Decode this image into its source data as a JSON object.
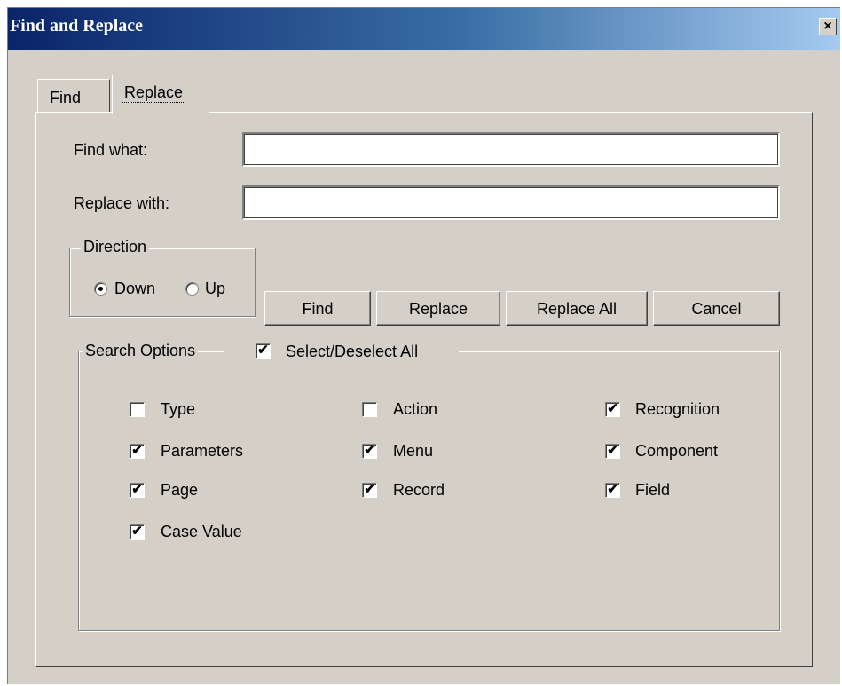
{
  "window": {
    "title": "Find and Replace",
    "close_glyph": "×"
  },
  "tabs": [
    {
      "label": "Find",
      "selected": false
    },
    {
      "label": "Replace",
      "selected": true
    }
  ],
  "fields": {
    "find_what": {
      "label": "Find what:",
      "value": ""
    },
    "replace_with": {
      "label": "Replace with:",
      "value": ""
    }
  },
  "direction": {
    "legend": "Direction",
    "options": [
      {
        "label": "Down",
        "selected": true
      },
      {
        "label": "Up",
        "selected": false
      }
    ]
  },
  "buttons": {
    "find": "Find",
    "replace": "Replace",
    "replace_all": "Replace All",
    "cancel": "Cancel"
  },
  "search_options": {
    "legend": "Search Options",
    "select_all": {
      "label": "Select/Deselect All",
      "checked": true
    },
    "items": [
      {
        "label": "Type",
        "checked": false
      },
      {
        "label": "Parameters",
        "checked": true
      },
      {
        "label": "Page",
        "checked": true
      },
      {
        "label": "Case Value",
        "checked": true
      },
      {
        "label": "Action",
        "checked": false
      },
      {
        "label": "Menu",
        "checked": true
      },
      {
        "label": "Record",
        "checked": true
      },
      {
        "label": "Recognition",
        "checked": true
      },
      {
        "label": "Component",
        "checked": true
      },
      {
        "label": "Field",
        "checked": true
      }
    ]
  },
  "check_glyph": "✔"
}
